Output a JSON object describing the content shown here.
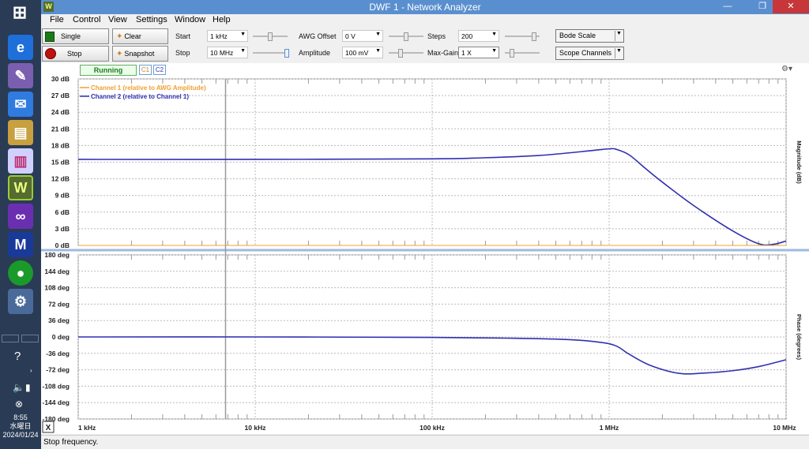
{
  "taskbar": {
    "start_label": "⊞",
    "clock_time": "8:55",
    "clock_day": "水曜日",
    "clock_date": "2024/01/24"
  },
  "window": {
    "title": "DWF 1 - Network Analyzer",
    "minimize": "—",
    "restore": "❐",
    "close": "✕"
  },
  "menu": {
    "file": "File",
    "control": "Control",
    "view": "View",
    "settings": "Settings",
    "window": "Window",
    "help": "Help"
  },
  "toolbar": {
    "single": "Single",
    "stop": "Stop",
    "clear": "Clear",
    "snapshot": "Snapshot",
    "start_label": "Start",
    "start_value": "1 kHz",
    "stop_label": "Stop",
    "stop_value": "10 MHz",
    "awg_offset_label": "AWG Offset",
    "awg_offset_value": "0 V",
    "amplitude_label": "Amplitude",
    "amplitude_value": "100 mV",
    "steps_label": "Steps",
    "steps_value": "200",
    "maxgain_label": "Max-Gain",
    "maxgain_value": "1 X",
    "bode_scale": "Bode Scale",
    "scope_channels": "Scope Channels"
  },
  "plot_header": {
    "status": "Running",
    "c1": "C1",
    "c2": "C2"
  },
  "legend": {
    "ch1": "Channel 1 (relative to AWG Amplitude)",
    "ch2": "Channel 2 (relative to Channel 1)",
    "ch1_color": "#f0a030",
    "ch2_color": "#3030b0"
  },
  "magnitude_axis": {
    "title": "Magnitude (dB)",
    "ticks": [
      "30 dB",
      "27 dB",
      "24 dB",
      "21 dB",
      "18 dB",
      "15 dB",
      "12 dB",
      "9 dB",
      "6 dB",
      "3 dB",
      "0 dB"
    ]
  },
  "phase_axis": {
    "title": "Phase (degrees)",
    "ticks": [
      "180 deg",
      "144 deg",
      "108 deg",
      "72 deg",
      "36 deg",
      "0 deg",
      "-36 deg",
      "-72 deg",
      "-108 deg",
      "-144 deg",
      "-180 deg"
    ]
  },
  "freq_axis": {
    "ticks": [
      "1 kHz",
      "10 kHz",
      "100 kHz",
      "1 MHz",
      "10 MHz"
    ]
  },
  "x_button": "X",
  "status_text": "Stop frequency.",
  "chart_data": {
    "type": "line",
    "xscale": "log",
    "x_range_hz": [
      1000,
      10000000
    ],
    "magnitude": {
      "ylim": [
        0,
        30
      ],
      "series": [
        {
          "name": "Channel 2 (relative to Channel 1)",
          "x": [
            1000,
            10000,
            100000,
            200000,
            400000,
            700000,
            1000000,
            1100000,
            1300000,
            1600000,
            2000000,
            3000000,
            5000000,
            7000000,
            8500000,
            10000000
          ],
          "y": [
            15.5,
            15.5,
            15.6,
            15.8,
            16.2,
            16.9,
            17.4,
            17.3,
            16.3,
            13.9,
            11.4,
            7.2,
            2.6,
            0.3,
            0.2,
            0.8
          ]
        },
        {
          "name": "Channel 1 (relative to AWG Amplitude)",
          "x": [
            1000,
            10000000
          ],
          "y": [
            0,
            0
          ]
        }
      ]
    },
    "phase": {
      "ylim": [
        -180,
        180
      ],
      "series": [
        {
          "name": "Channel 2 (relative to Channel 1)",
          "x": [
            1000,
            10000,
            100000,
            300000,
            600000,
            900000,
            1100000,
            1300000,
            1700000,
            2500000,
            3500000,
            5000000,
            7000000,
            10000000
          ],
          "y": [
            0,
            0,
            -1,
            -3,
            -6,
            -12,
            -20,
            -38,
            -62,
            -80,
            -79,
            -74,
            -65,
            -50
          ]
        }
      ]
    }
  }
}
